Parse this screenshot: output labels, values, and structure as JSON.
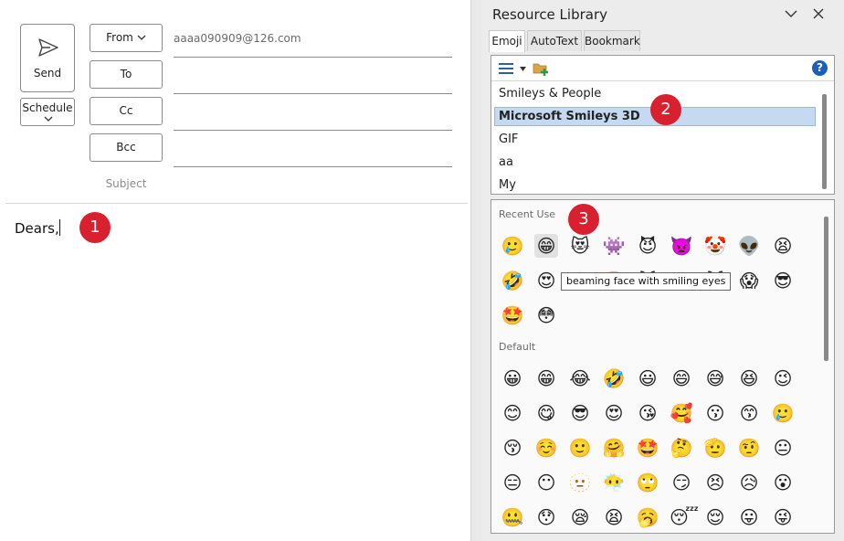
{
  "compose": {
    "send_label": "Send",
    "schedule_label": "Schedule",
    "from_label": "From",
    "to_label": "To",
    "cc_label": "Cc",
    "bcc_label": "Bcc",
    "from_value": "aaaa090909@126.com",
    "subject_label": "Subject",
    "body_text": "Dears,"
  },
  "markers": [
    "1",
    "2",
    "3"
  ],
  "library": {
    "title": "Resource Library",
    "tabs": [
      "Emoji",
      "AutoText",
      "Bookmark"
    ],
    "active_tab": "Emoji",
    "help_label": "?",
    "categories": [
      "Smileys & People",
      "Microsoft Smileys 3D",
      "GIF",
      "aa",
      "My"
    ],
    "selected_category": "Microsoft Smileys 3D",
    "recent_title": "Recent Use",
    "default_title": "Default",
    "tooltip": "beaming face with smiling eyes",
    "recent_emojis": [
      "🥲",
      "😁",
      "😻",
      "👾",
      "😈",
      "👿",
      "🤡",
      "👽",
      "😫",
      "🤣",
      "😍",
      "😁",
      "🤗",
      "🙀",
      "😵",
      "😿",
      "😱",
      "😎",
      "🤩",
      "😳"
    ],
    "default_emojis": [
      "😀",
      "😁",
      "😂",
      "🤣",
      "😃",
      "😄",
      "😅",
      "😆",
      "😉",
      "😊",
      "😋",
      "😎",
      "😍",
      "😘",
      "🥰",
      "😗",
      "😙",
      "🥲",
      "😚",
      "☺️",
      "🙂",
      "🤗",
      "🤩",
      "🤔",
      "🫡",
      "🤨",
      "😐",
      "😑",
      "😶",
      "🫥",
      "😶‍🌫️",
      "🙄",
      "😏",
      "😣",
      "😥",
      "😮",
      "🤐",
      "😯",
      "😪",
      "😫",
      "🥱",
      "😴",
      "😌",
      "😛",
      "😜"
    ]
  }
}
